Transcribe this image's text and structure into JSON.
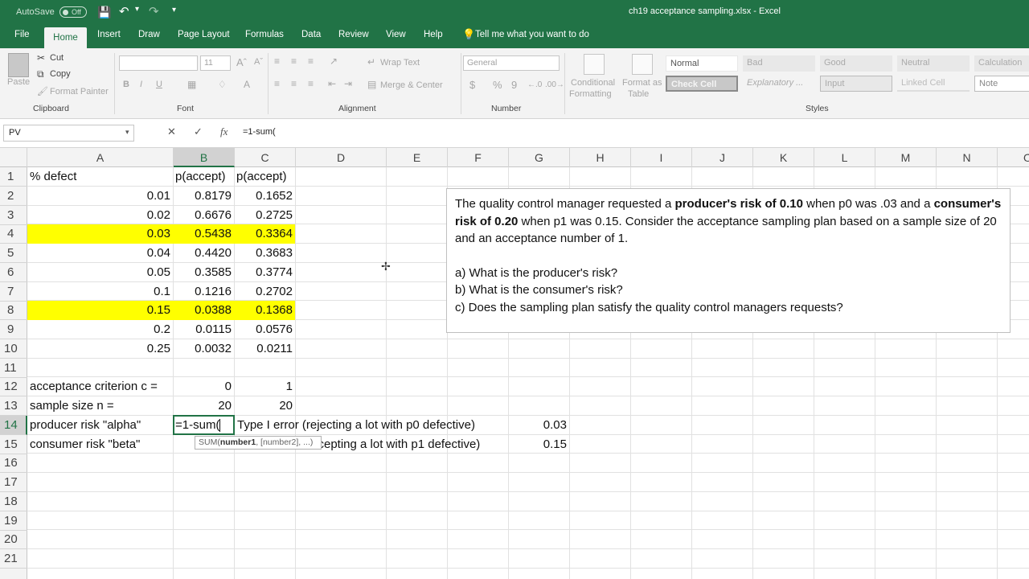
{
  "titlebar": {
    "autosave_label": "AutoSave",
    "autosave_state": "Off",
    "title": "ch19 acceptance sampling.xlsx  -  Excel"
  },
  "tabs": [
    "File",
    "Home",
    "Insert",
    "Draw",
    "Page Layout",
    "Formulas",
    "Data",
    "Review",
    "View",
    "Help"
  ],
  "tell_me": "Tell me what you want to do",
  "ribbon": {
    "clipboard": {
      "paste": "Paste",
      "cut": "Cut",
      "copy": "Copy",
      "format_painter": "Format Painter",
      "label": "Clipboard"
    },
    "font": {
      "size": "11",
      "bold": "B",
      "italic": "I",
      "underline": "U",
      "label": "Font"
    },
    "alignment": {
      "wrap_text": "Wrap Text",
      "merge_center": "Merge & Center",
      "label": "Alignment"
    },
    "number": {
      "format": "General",
      "currency": "$",
      "percent": "%",
      "comma": "9",
      "label": "Number"
    },
    "styles": {
      "conditional": "Conditional",
      "formatting": "Formatting",
      "format_as": "Format as",
      "table": "Table",
      "label": "Styles",
      "cells": [
        "Normal",
        "Bad",
        "Good",
        "Neutral",
        "Calculation",
        "Check Cell",
        "Explanatory ...",
        "Input",
        "Linked Cell",
        "Note"
      ]
    },
    "colors": {
      "normal": "#ffffff",
      "bad": "#ffc7ce",
      "good": "#c6efce",
      "neutral": "#ffeb9c",
      "calculation": "#f2f2f2",
      "check_cell": "#a5a5a5",
      "input": "#ffcc99",
      "note": "#ffffcc"
    }
  },
  "formula_bar": {
    "name_box": "PV",
    "formula": "=1-sum("
  },
  "columns": [
    "A",
    "B",
    "C",
    "D",
    "E",
    "F",
    "G",
    "H",
    "I",
    "J",
    "K",
    "L",
    "M",
    "N",
    "O"
  ],
  "rows": [
    "1",
    "2",
    "3",
    "4",
    "5",
    "6",
    "7",
    "8",
    "9",
    "10",
    "11",
    "12",
    "13",
    "14",
    "15",
    "16",
    "17",
    "18",
    "19",
    "20",
    "21"
  ],
  "sheet": {
    "header": {
      "a": "% defect",
      "b": "p(accept)",
      "c": "p(accept)"
    },
    "table": [
      {
        "a": "0.01",
        "b": "0.8179",
        "c": "0.1652"
      },
      {
        "a": "0.02",
        "b": "0.6676",
        "c": "0.2725"
      },
      {
        "a": "0.03",
        "b": "0.5438",
        "c": "0.3364"
      },
      {
        "a": "0.04",
        "b": "0.4420",
        "c": "0.3683"
      },
      {
        "a": "0.05",
        "b": "0.3585",
        "c": "0.3774"
      },
      {
        "a": "0.1",
        "b": "0.1216",
        "c": "0.2702"
      },
      {
        "a": "0.15",
        "b": "0.0388",
        "c": "0.1368"
      },
      {
        "a": "0.2",
        "b": "0.0115",
        "c": "0.0576"
      },
      {
        "a": "0.25",
        "b": "0.0032",
        "c": "0.0211"
      }
    ],
    "highlight_color": "#ffff00",
    "criterion": {
      "label": "acceptance criterion c =",
      "b": "0",
      "c": "1"
    },
    "sample": {
      "label": "sample size n =",
      "b": "20",
      "c": "20"
    },
    "producer": {
      "label": "producer risk \"alpha\"",
      "editing": "=1-sum(",
      "note": "Type I error (rejecting a lot with p0 defective)",
      "g": "0.03"
    },
    "consumer": {
      "label": "consumer risk \"beta\"",
      "note": "ccepting a lot with p1 defective)",
      "g": "0.15"
    },
    "tooltip": {
      "fn": "SUM(",
      "arg1": "number1",
      "rest": ", [number2], ...)"
    }
  },
  "textbox": {
    "p1_a": "The quality control manager requested a ",
    "p1_b": "producer's risk of 0.10",
    "p1_c": " when p0 was .03 and a ",
    "p1_d": "consumer's risk of 0.20",
    "p1_e": " when p1 was 0.15.  Consider the acceptance sampling plan based on a sample size of 20 and an acceptance number of 1.",
    "qa": "a) What is the producer's risk?",
    "qb": "b) What is the consumer's risk?",
    "qc": "c) Does the sampling plan satisfy the quality control managers requests?"
  }
}
